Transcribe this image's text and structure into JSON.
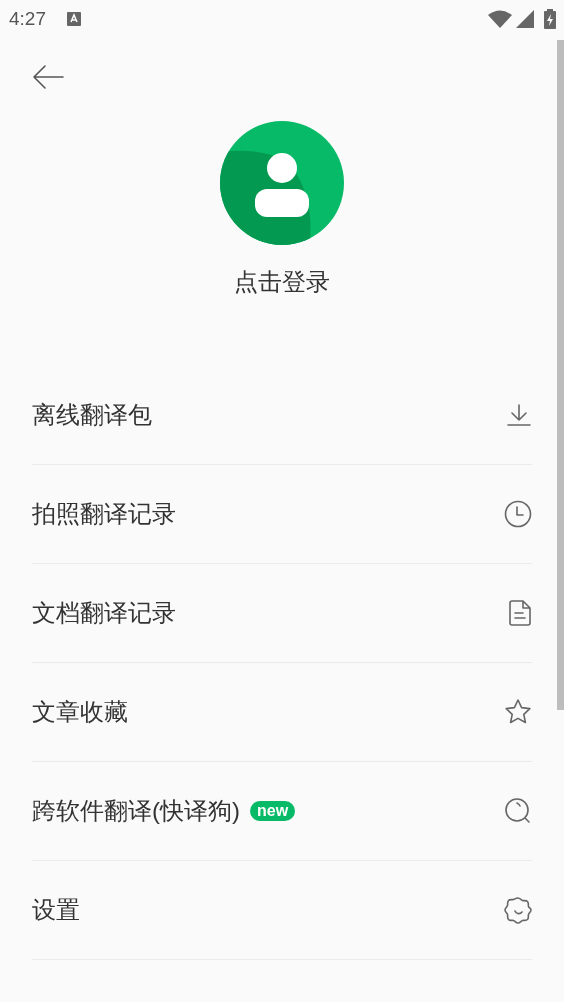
{
  "status_bar": {
    "time": "4:27"
  },
  "profile": {
    "login_label": "点击登录"
  },
  "menu": [
    {
      "label": "离线翻译包"
    },
    {
      "label": "拍照翻译记录"
    },
    {
      "label": "文档翻译记录"
    },
    {
      "label": "文章收藏"
    },
    {
      "label": "跨软件翻译(快译狗)",
      "badge": "new"
    },
    {
      "label": "设置"
    }
  ]
}
